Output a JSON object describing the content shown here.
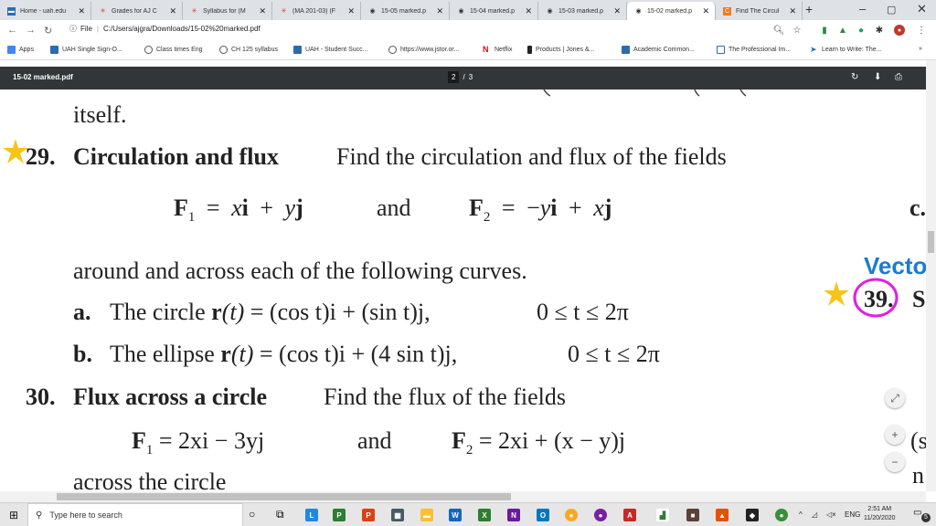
{
  "browser": {
    "tabs": [
      {
        "label": "Home - uah.edu",
        "icon": "uah-icon",
        "color": "#2b6cb0"
      },
      {
        "label": "Grades for AJ C",
        "icon": "canvas-icon",
        "color": "#e13f2b"
      },
      {
        "label": "Syllabus for (M",
        "icon": "canvas-icon",
        "color": "#e13f2b"
      },
      {
        "label": "(MA 201-03) (F",
        "icon": "canvas-icon",
        "color": "#e13f2b"
      },
      {
        "label": "15-05 marked.p",
        "icon": "globe-icon",
        "color": "#444"
      },
      {
        "label": "15-04 marked.p",
        "icon": "globe-icon",
        "color": "#444"
      },
      {
        "label": "15-03 marked.p",
        "icon": "globe-icon",
        "color": "#444"
      },
      {
        "label": "15-02 marked.p",
        "icon": "globe-icon",
        "color": "#444",
        "active": true
      },
      {
        "label": "Find The Circul",
        "icon": "chegg-icon",
        "color": "#f07a1f"
      }
    ],
    "new_tab": "+",
    "window_controls": {
      "minimize": "–",
      "maximize": "▢",
      "close": "✕"
    },
    "address": {
      "prefix": "File",
      "url": "C:/Users/ajgra/Downloads/15-02%20marked.pdf"
    },
    "bookmarks": [
      {
        "label": "Apps",
        "color": "#4285f4"
      },
      {
        "label": "UAH Single Sign-O...",
        "color": "#2b6cb0"
      },
      {
        "label": "Class times Eng",
        "color": "#555"
      },
      {
        "label": "CH 125 syllabus",
        "color": "#555"
      },
      {
        "label": "UAH - Student Succ...",
        "color": "#2b6cb0"
      },
      {
        "label": "https://www.jstor.or...",
        "color": "#555"
      },
      {
        "label": "Netflix",
        "color": "#e50914"
      },
      {
        "label": "Products | Jones &...",
        "color": "#222"
      },
      {
        "label": "Academic Common...",
        "color": "#2b6cb0"
      },
      {
        "label": "The Professional Im...",
        "color": "#2b6cb0"
      },
      {
        "label": "Learn to Write: The...",
        "color": "#2b6cb0"
      }
    ],
    "bookmarks_more": "»"
  },
  "pdf": {
    "title": "15-02 marked.pdf",
    "current_page": "2",
    "page_sep": "/",
    "total_pages": "3"
  },
  "content": {
    "itself": "itself.",
    "p29_num": "29.",
    "p29_head": "Circulation and flux",
    "p29_text": "Find the circulation and flux of the fields",
    "f1_label": "F",
    "f1_sub": "1",
    "f1_eq": "=",
    "f1_x": "x",
    "f1_i": "i",
    "f1_plus": "+",
    "f1_y": "y",
    "f1_j": "j",
    "and1": "and",
    "f2_label": "F",
    "f2_sub": "2",
    "f2_eq": "=",
    "f2_minus": "−",
    "f2_y": "y",
    "f2_i": "i",
    "f2_plus": "+",
    "f2_x": "x",
    "f2_j": "j",
    "around_text": "around and across each of the following curves.",
    "a_label": "a.",
    "a_text1": "The circle",
    "a_r": "r",
    "a_t": "(t)",
    "a_rest": "= (cos t)i + (sin t)j,",
    "a_range": "0 ≤ t ≤ 2π",
    "b_label": "b.",
    "b_text1": "The ellipse",
    "b_r": "r",
    "b_t": "(t)",
    "b_rest": "= (cos t)i + (4 sin t)j,",
    "b_range": "0 ≤ t ≤ 2π",
    "p30_num": "30.",
    "p30_head": "Flux across a circle",
    "p30_text": "Find the flux of the fields",
    "g1_label": "F",
    "g1_sub": "1",
    "g1_rest": "= 2xi − 3yj",
    "and2": "and",
    "g2_label": "F",
    "g2_sub": "2",
    "g2_rest": "= 2xi + (x − y)j",
    "across_text": "across the circle",
    "right_c": "c.",
    "right_vecto": "Vecto",
    "right_39": "39.",
    "right_s": "S",
    "right_paren": "(s",
    "right_n": "n",
    "zoom_in": "+",
    "zoom_out": "−",
    "fit": "⤢"
  },
  "taskbar": {
    "search_placeholder": "Type here to search",
    "language": "ENG",
    "time": "2:51 AM",
    "date": "11/20/2020",
    "notifications": "5"
  },
  "colors": {
    "star": "#f5c518",
    "circle": "#e020e0",
    "heading_blue": "#1a7bd1"
  }
}
